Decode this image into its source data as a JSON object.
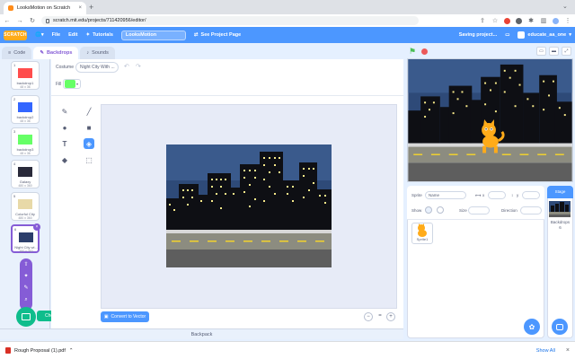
{
  "browser": {
    "tab_title": "LooksMotion on Scratch",
    "tab_close": "×",
    "new_tab": "+",
    "url": "scratch.mit.edu/projects/711420956/editor/",
    "nav_back": "←",
    "nav_forward": "→",
    "nav_reload": "↻",
    "menu_dots": "⋮"
  },
  "menubar": {
    "logo": "SCRATCH",
    "file": "File",
    "edit": "Edit",
    "tutorials": "Tutorials",
    "project_title": "LooksMotion",
    "see_project_page": "See Project Page",
    "saving": "Saving project...",
    "username": "educate_aa_one"
  },
  "editor_tabs": {
    "code": "Code",
    "backdrops": "Backdrops",
    "sounds": "Sounds"
  },
  "backdrops": [
    {
      "num": "1",
      "name": "backdrop1",
      "size": "48 x 36",
      "color": "#ff4d4d"
    },
    {
      "num": "2",
      "name": "backdrop2",
      "size": "48 x 36",
      "color": "#3366ff"
    },
    {
      "num": "3",
      "name": "backdrop3",
      "size": "48 x 36",
      "color": "#66ff66"
    },
    {
      "num": "4",
      "name": "Galaxy",
      "size": "480 x 360",
      "color": "#2a2a3a"
    },
    {
      "num": "5",
      "name": "Colorful City",
      "size": "480 x 360",
      "color": "#e8d9a8"
    },
    {
      "num": "6",
      "name": "Night City wi...",
      "size": "480 x 360",
      "color": "#2c3e6b"
    }
  ],
  "paint": {
    "costume_label": "Costume",
    "costume_name": "Night City With ...",
    "fill_label": "Fill",
    "fill_color": "#66ff66",
    "convert_button": "Convert to Vector"
  },
  "add_backdrop_tooltip": "Choose a Backdrop",
  "backpack": "Backpack",
  "sprite_info": {
    "sprite_label": "Sprite",
    "sprite_name": "Name",
    "x_label": "x",
    "y_label": "y",
    "show_label": "Show",
    "size_label": "Size",
    "direction_label": "Direction"
  },
  "sprite_tile_name": "Sprite1",
  "stage_panel": {
    "header": "Stage",
    "backdrops_label": "Backdrops",
    "backdrops_count": "6"
  },
  "downloads": {
    "file": "Rough Proposal (1).pdf",
    "show_all": "Show All",
    "close": "×"
  }
}
